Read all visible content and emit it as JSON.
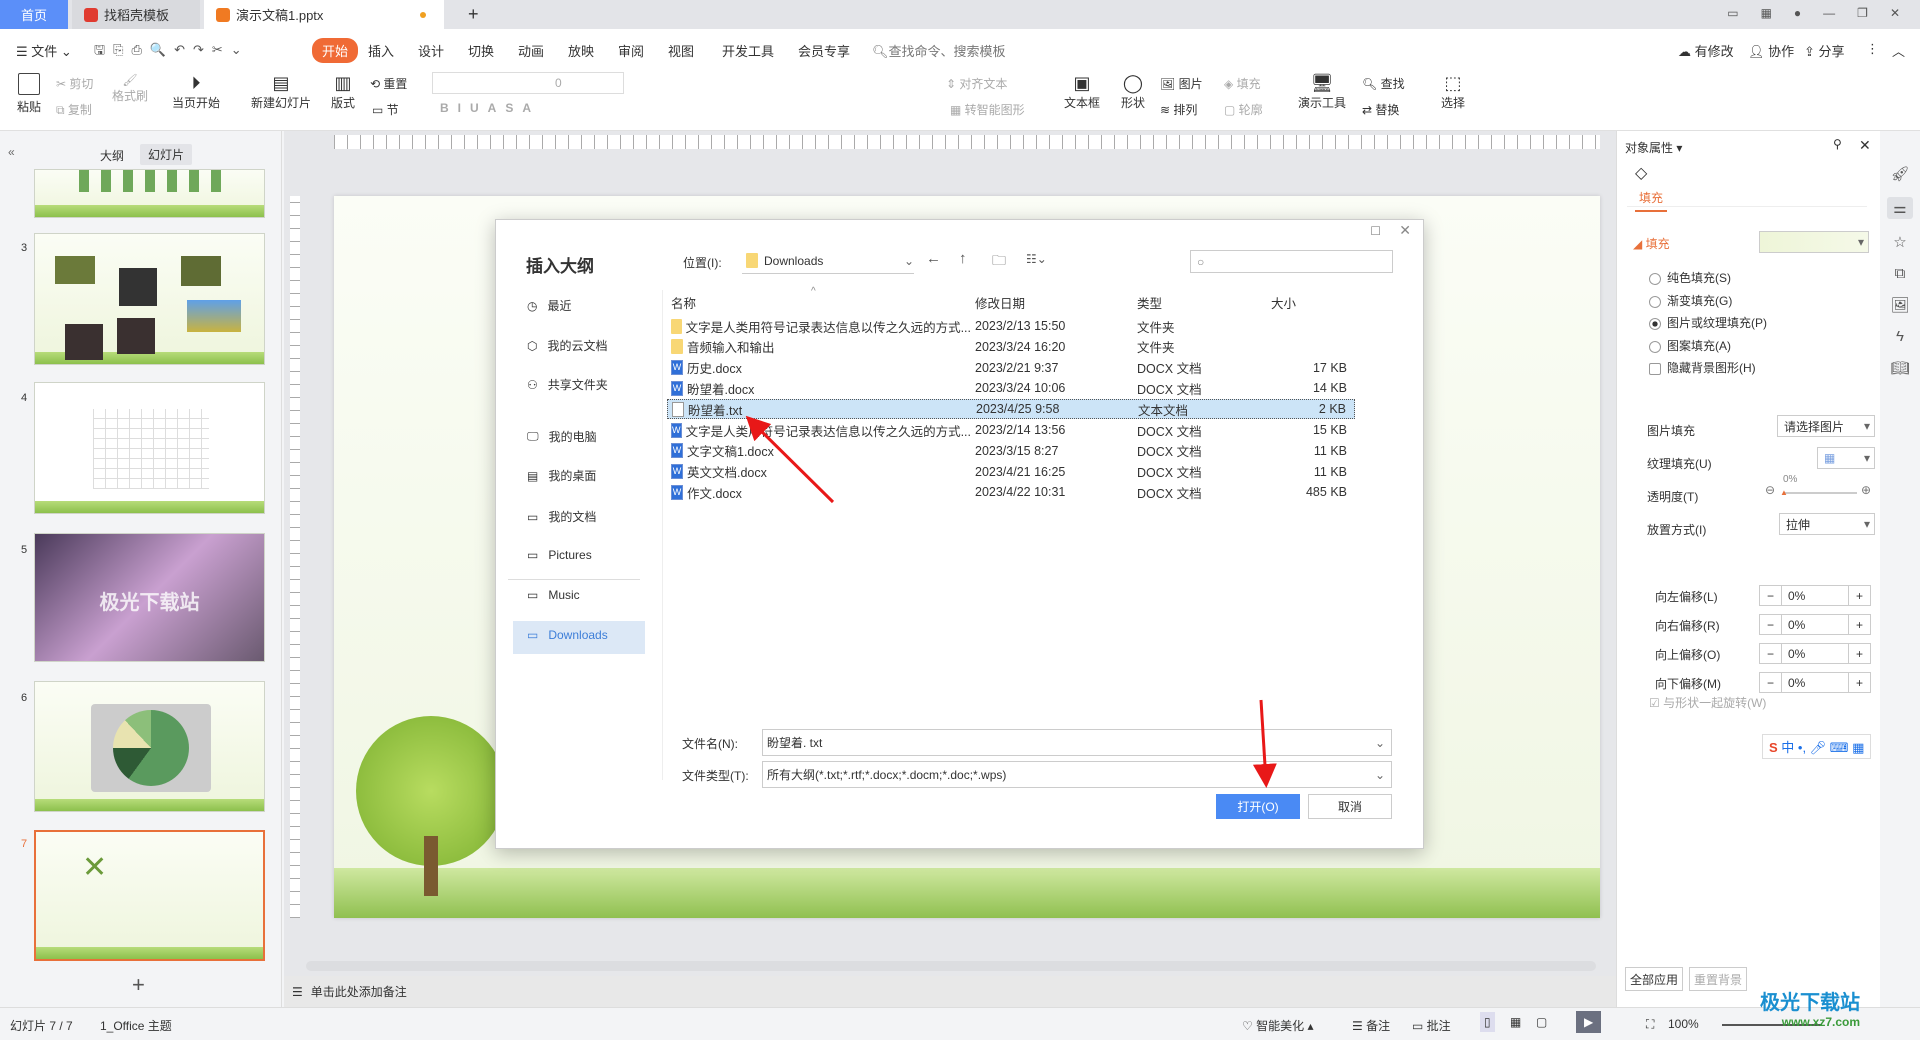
{
  "tabs": [
    {
      "label": "首页",
      "active": false
    },
    {
      "label": "找稻壳模板"
    },
    {
      "label": "演示文稿1.pptx"
    }
  ],
  "menu": {
    "file": "文件",
    "items": [
      "开始",
      "插入",
      "设计",
      "切换",
      "动画",
      "放映",
      "审阅",
      "视图",
      "开发工具",
      "会员专享"
    ],
    "search": "查找命令、搜索模板",
    "right": [
      "有修改",
      "协作",
      "分享"
    ],
    "active_color": "#f06a35"
  },
  "ribbon": {
    "paste": "粘贴",
    "cut": "剪切",
    "copy": "复制",
    "format_painter": "格式刷",
    "from_current": "当页开始",
    "new_slide": "新建幻灯片",
    "layout": "版式",
    "reset": "重置",
    "section": "节",
    "font_size": "0",
    "align_text": "对齐文本",
    "smartart": "转智能图形",
    "textbox": "文本框",
    "shape": "形状",
    "picture": "图片",
    "arrange": "排列",
    "fill": "填充",
    "outline": "轮廓",
    "tools": "演示工具",
    "find": "查找",
    "replace": "替换",
    "select": "选择"
  },
  "left_panel": {
    "tab_outline": "大纲",
    "tab_slides": "幻灯片",
    "slides": [
      "3",
      "4",
      "5",
      "6",
      "7"
    ],
    "slide5_text": "极光下载站",
    "add": "+"
  },
  "notes": {
    "placeholder": "单击此处添加备注"
  },
  "dialog": {
    "title": "插入大纲",
    "location_label": "位置(I):",
    "location": "Downloads",
    "search_placeholder": "",
    "nav": [
      "最近",
      "我的云文档",
      "共享文件夹",
      "我的电脑",
      "我的桌面",
      "我的文档",
      "Pictures",
      "Music",
      "Downloads"
    ],
    "columns": [
      "名称",
      "修改日期",
      "类型",
      "大小"
    ],
    "files": [
      {
        "name": "文字是人类用符号记录表达信息以传之久远的方式...",
        "date": "2023/2/13 15:50",
        "type": "文件夹",
        "size": "",
        "icon": "folder"
      },
      {
        "name": "音频输入和输出",
        "date": "2023/3/24 16:20",
        "type": "文件夹",
        "size": "",
        "icon": "folder"
      },
      {
        "name": "历史.docx",
        "date": "2023/2/21 9:37",
        "type": "DOCX 文档",
        "size": "17 KB",
        "icon": "word"
      },
      {
        "name": "盼望着.docx",
        "date": "2023/3/24 10:06",
        "type": "DOCX 文档",
        "size": "14 KB",
        "icon": "word"
      },
      {
        "name": "盼望着.txt",
        "date": "2023/4/25 9:58",
        "type": "文本文档",
        "size": "2 KB",
        "icon": "txt",
        "selected": true
      },
      {
        "name": "文字是人类用符号记录表达信息以传之久远的方式...",
        "date": "2023/2/14 13:56",
        "type": "DOCX 文档",
        "size": "15 KB",
        "icon": "word"
      },
      {
        "name": "文字文稿1.docx",
        "date": "2023/3/15 8:27",
        "type": "DOCX 文档",
        "size": "11 KB",
        "icon": "word"
      },
      {
        "name": "英文文档.docx",
        "date": "2023/4/21 16:25",
        "type": "DOCX 文档",
        "size": "11 KB",
        "icon": "word"
      },
      {
        "name": "作文.docx",
        "date": "2023/4/22 10:31",
        "type": "DOCX 文档",
        "size": "485 KB",
        "icon": "word"
      }
    ],
    "filename_label": "文件名(N):",
    "filename": "盼望着. txt",
    "filetype_label": "文件类型(T):",
    "filetype": "所有大纲(*.txt;*.rtf;*.docx;*.docm;*.doc;*.wps)",
    "open": "打开(O)",
    "cancel": "取消",
    "accent": "#3d85f4"
  },
  "right_panel": {
    "title": "对象属性",
    "tab": "填充",
    "section": "填充",
    "options": [
      {
        "label": "纯色填充(S)",
        "checked": false
      },
      {
        "label": "渐变填充(G)",
        "checked": false
      },
      {
        "label": "图片或纹理填充(P)",
        "checked": true
      },
      {
        "label": "图案填充(A)",
        "checked": false
      }
    ],
    "hide_bg": "隐藏背景图形(H)",
    "picture_fill": "图片填充",
    "picture_fill_value": "请选择图片",
    "texture_fill": "纹理填充(U)",
    "transparency": "透明度(T)",
    "transparency_value": "0%",
    "placement": "放置方式(I)",
    "placement_value": "拉伸",
    "offsets": [
      {
        "label": "向左偏移(L)",
        "value": "0%"
      },
      {
        "label": "向右偏移(R)",
        "value": "0%"
      },
      {
        "label": "向上偏移(O)",
        "value": "0%"
      },
      {
        "label": "向下偏移(M)",
        "value": "0%"
      }
    ],
    "rotate_with_shape": "与形状一起旋转(W)",
    "apply_all": "全部应用",
    "reset_bg": "重置背景"
  },
  "status": {
    "slide": "幻灯片 7 / 7",
    "theme": "1_Office 主题",
    "beautify": "智能美化",
    "notes": "备注",
    "comments": "批注",
    "zoom": "100%"
  },
  "watermark": {
    "text": "极光下载站",
    "url": "www.xz7.com"
  }
}
